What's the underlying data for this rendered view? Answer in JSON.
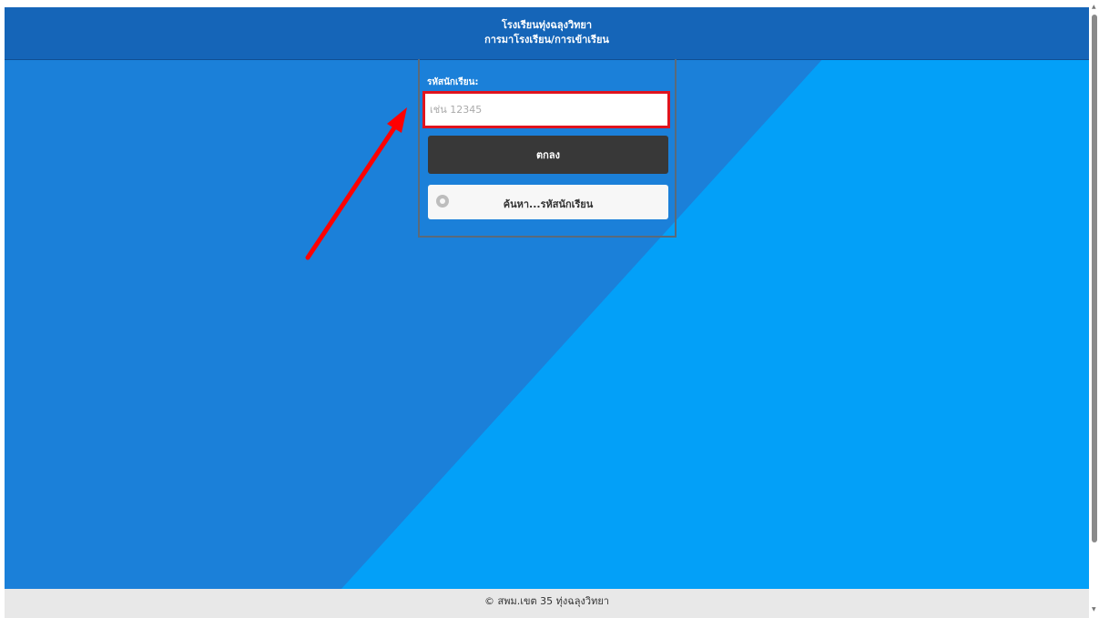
{
  "header": {
    "school_name": "โรงเรียนทุ่งฉลุงวิทยา",
    "page_subtitle": "การมาโรงเรียน/การเข้าเรียน"
  },
  "form": {
    "field_label": "รหัสนักเรียน:",
    "student_id_placeholder": "เช่น 12345",
    "student_id_value": "",
    "ok_label": "ตกลง",
    "search_label": "ค้นหา...รหัสนักเรียน"
  },
  "annotation": {
    "highlight_color": "#e0141e",
    "arrow_color": "#ff0000"
  },
  "footer": {
    "text": "© สพม.เขต 35 ทุ่งฉลุงวิทยา"
  },
  "colors": {
    "header_bg": "#1565b8",
    "bg_dark_blue": "#1b80d9",
    "bg_light_blue": "#03a0f8",
    "ok_button_bg": "#383838"
  }
}
